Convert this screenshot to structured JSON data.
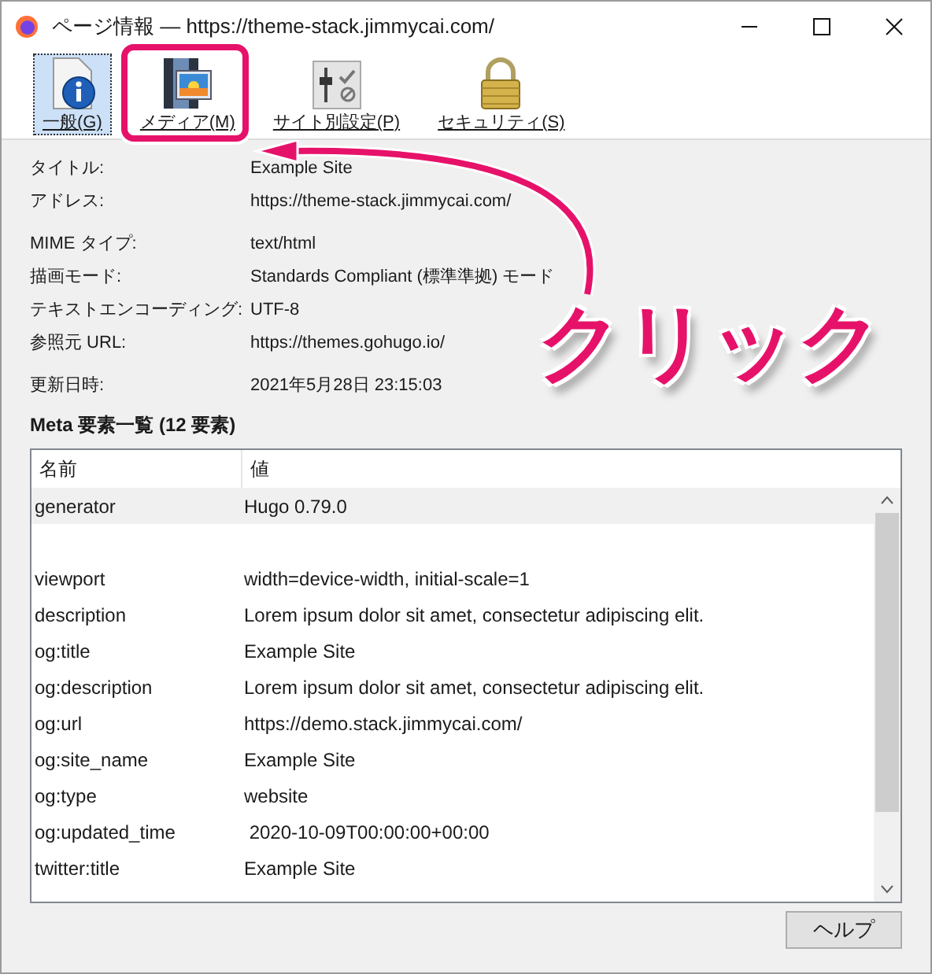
{
  "window": {
    "title": "ページ情報 — https://theme-stack.jimmycai.com/"
  },
  "tabs": [
    {
      "label": "一般(G)",
      "kind": "info",
      "selected": true
    },
    {
      "label": "メディア(M)",
      "kind": "media",
      "selected": false
    },
    {
      "label": "サイト別設定(P)",
      "kind": "settings",
      "selected": false
    },
    {
      "label": "セキュリティ(S)",
      "kind": "lock",
      "selected": false
    }
  ],
  "field_groups": [
    [
      {
        "label": "タイトル:",
        "value": "Example Site"
      },
      {
        "label": "アドレス:",
        "value": "https://theme-stack.jimmycai.com/"
      }
    ],
    [
      {
        "label": "MIME タイプ:",
        "value": "text/html"
      },
      {
        "label": "描画モード:",
        "value": "Standards Compliant (標準準拠) モード"
      },
      {
        "label": "テキストエンコーディング:",
        "value": "UTF-8"
      },
      {
        "label": "参照元 URL:",
        "value": "https://themes.gohugo.io/"
      }
    ],
    [
      {
        "label": "更新日時:",
        "value": "2021年5月28日 23:15:03"
      }
    ]
  ],
  "meta": {
    "heading": "Meta 要素一覧 (12 要素)",
    "columns": [
      "名前",
      "値"
    ],
    "rows": [
      {
        "kind": "entry",
        "name": "generator",
        "value": "Hugo 0.79.0",
        "selected": true
      },
      {
        "kind": "empty"
      },
      {
        "kind": "entry",
        "name": "viewport",
        "value": "width=device-width, initial-scale=1",
        "selected": false
      },
      {
        "kind": "entry",
        "name": "description",
        "value": "Lorem ipsum dolor sit amet, consectetur adipiscing elit.",
        "selected": false
      },
      {
        "kind": "entry",
        "name": "og:title",
        "value": "Example Site",
        "selected": false
      },
      {
        "kind": "entry",
        "name": "og:description",
        "value": "Lorem ipsum dolor sit amet, consectetur adipiscing elit.",
        "selected": false
      },
      {
        "kind": "entry",
        "name": "og:url",
        "value": "https://demo.stack.jimmycai.com/",
        "selected": false
      },
      {
        "kind": "entry",
        "name": "og:site_name",
        "value": "Example Site",
        "selected": false
      },
      {
        "kind": "entry",
        "name": "og:type",
        "value": "website",
        "selected": false
      },
      {
        "kind": "entry",
        "name": "og:updated_time",
        "value": " 2020-10-09T00:00:00+00:00",
        "selected": false
      },
      {
        "kind": "entry",
        "name": "twitter:title",
        "value": "Example Site",
        "selected": false
      }
    ]
  },
  "help_button": "ヘルプ",
  "annotation": {
    "text": "クリック"
  }
}
